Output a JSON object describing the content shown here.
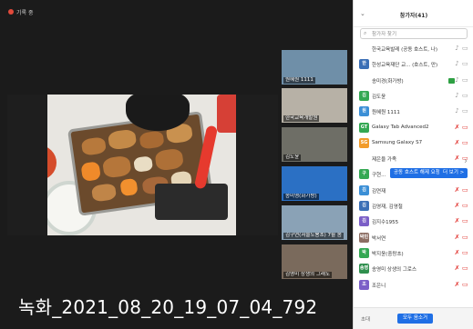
{
  "recording": {
    "label": "기록 중"
  },
  "watermark": "녹화_2021_08_20_19_07_04_792",
  "thumbnails": [
    {
      "name": "원혜원 1111",
      "color": "#6f8fa8"
    },
    {
      "name": "한국교육개발원",
      "color": "#b7b1a6"
    },
    {
      "name": "김도윤",
      "color": "#6e6e66"
    },
    {
      "name": "송미영(화가방)",
      "color": "#2b70c4"
    },
    {
      "name": "김구연(서울도봉초) 7월 봄",
      "color": "#8aa2b6"
    },
    {
      "name": "김영미 상생의 그래도",
      "color": "#7a6a5c"
    }
  ],
  "panel": {
    "title": "참가자(41)",
    "search_placeholder": "참가자 찾기",
    "participants": [
      {
        "avatar": "",
        "avatar_color": "#ffffff",
        "name": "한국교육발레 (공동 호스트, 나)",
        "mic": "on",
        "cam": "on"
      },
      {
        "avatar": "한",
        "avatar_color": "#3b6fb6",
        "name": "한성교육재단 교... (호스트, 만)",
        "mic": "on",
        "cam": "on"
      },
      {
        "avatar": "",
        "avatar_color": "#ffffff",
        "name": "송미경(화가방)",
        "mic": "on",
        "cam": "green"
      },
      {
        "avatar": "김",
        "avatar_color": "#34a853",
        "name": "김도윤",
        "mic": "on",
        "cam": "on"
      },
      {
        "avatar": "원",
        "avatar_color": "#3b8fd6",
        "name": "원혜원 1111",
        "mic": "on",
        "cam": "on"
      },
      {
        "avatar": "GT",
        "avatar_color": "#34a853",
        "name": "Galaxy Tab Advanced2",
        "mic": "muted",
        "cam": "off"
      },
      {
        "avatar": "SG",
        "avatar_color": "#f29c2b",
        "name": "Samsung Galaxy S7",
        "mic": "muted",
        "cam": "off"
      },
      {
        "avatar": "",
        "avatar_color": "#ffffff",
        "name": "제은을 가족",
        "mic": "muted",
        "cam": "off"
      },
      {
        "avatar": "구",
        "avatar_color": "#34a853",
        "name": "구현...",
        "mic": "muted",
        "cam": "off"
      },
      {
        "avatar": "김",
        "avatar_color": "#3b8fd6",
        "name": "김연재",
        "mic": "muted",
        "cam": "off"
      },
      {
        "avatar": "김",
        "avatar_color": "#3b6fb6",
        "name": "김영재, 김영철",
        "mic": "muted",
        "cam": "off"
      },
      {
        "avatar": "김",
        "avatar_color": "#7b5fc7",
        "name": "김지수1955",
        "mic": "muted",
        "cam": "off"
      },
      {
        "avatar": "박민",
        "avatar_color": "#8d6e63",
        "name": "박서연",
        "mic": "muted",
        "cam": "off"
      },
      {
        "avatar": "박",
        "avatar_color": "#34a853",
        "name": "박지윤(중랑초)",
        "mic": "muted",
        "cam": "off"
      },
      {
        "avatar": "송영",
        "avatar_color": "#2f8f4e",
        "name": "송영미 상생의 그로스",
        "mic": "muted",
        "cam": "off"
      },
      {
        "avatar": "조",
        "avatar_color": "#7b5fc7",
        "name": "조은니",
        "mic": "muted",
        "cam": "off"
      }
    ],
    "row_actions": {
      "make_host_label": "공동 호스트 해제 요청",
      "more_label": "더 보기 >"
    },
    "footer_label": "초대",
    "footer_button": "모두 음소거"
  },
  "icons": {
    "search": "search-icon",
    "mic": "mic-icon",
    "camera": "camera-icon",
    "chevron": "chevron-down-icon",
    "next": "chevron-right-icon"
  }
}
